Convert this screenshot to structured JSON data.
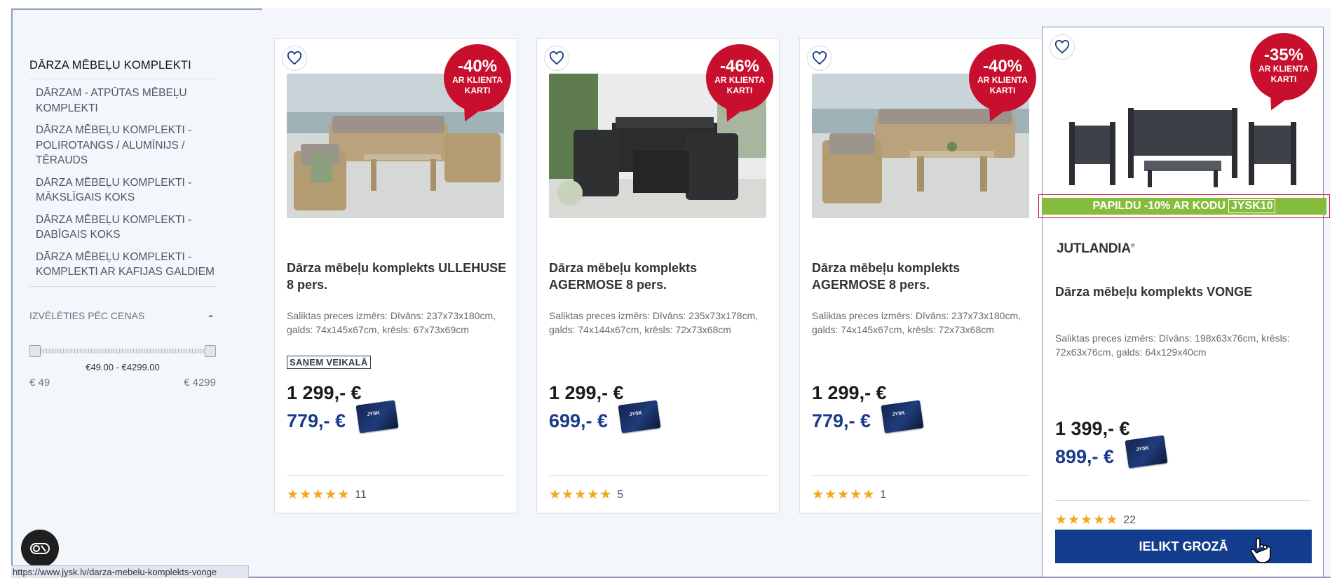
{
  "sidebar": {
    "title": "DĀRZA MĒBEĻU KOMPLEKTI",
    "items": [
      {
        "label": "DĀRZAM - ATPŪTAS MĒBEĻU KOMPLEKTI"
      },
      {
        "label": "DĀRZA MĒBEĻU KOMPLEKTI - POLIROTANGS / ALUMĪNIJS / TĒRAUDS"
      },
      {
        "label": "DĀRZA MĒBEĻU KOMPLEKTI - MĀKSLĪGAIS KOKS"
      },
      {
        "label": "DĀRZA MĒBEĻU KOMPLEKTI - DABĪGAIS KOKS"
      },
      {
        "label": "DĀRZA MĒBEĻU KOMPLEKTI - KOMPLEKTI AR KAFIJAS GALDIEM"
      }
    ],
    "price_filter": {
      "label": "IZVĒLĒTIES PĒC CENAS",
      "collapse": "-",
      "range": "€49.00 - €4299.00",
      "min": "€ 49",
      "max": "€ 4299"
    }
  },
  "products": [
    {
      "discount": "-40%",
      "badge_text": "AR KLIENTA KARTI",
      "name": "Dārza mēbeļu komplekts ULLEHUSE 8 pers.",
      "dims": "Saliktas preces izmērs: Dīvāns: 237x73x180cm, galds: 74x145x67cm, krēsls: 67x73x69cm",
      "pickup": "SAŅEM VEIKALĀ",
      "price_old": "1 299,- €",
      "price_new": "779,- €",
      "rating_count": "11"
    },
    {
      "discount": "-46%",
      "badge_text": "AR KLIENTA KARTI",
      "name": "Dārza mēbeļu komplekts AGERMOSE 8 pers.",
      "dims": "Saliktas preces izmērs: Dīvāns: 235x73x178cm, galds: 74x144x67cm, krēsls: 72x73x68cm",
      "price_old": "1 299,- €",
      "price_new": "699,- €",
      "rating_count": "5"
    },
    {
      "discount": "-40%",
      "badge_text": "AR KLIENTA KARTI",
      "name": "Dārza mēbeļu komplekts AGERMOSE 8 pers.",
      "dims": "Saliktas preces izmērs: Dīvāns: 237x73x180cm, galds: 74x145x67cm, krēsls: 72x73x68cm",
      "price_old": "1 299,- €",
      "price_new": "779,- €",
      "rating_count": "1"
    },
    {
      "discount": "-35%",
      "badge_text": "AR KLIENTA KARTI",
      "promo": "PAPILDU -10% AR KODU",
      "promo_code": "JYSK10",
      "brand": "JUTLANDIA",
      "brand_mark": "®",
      "name": "Dārza mēbeļu komplekts VONGE",
      "dims": "Saliktas preces izmērs: Dīvāns: 198x63x76cm, krēsls: 72x63x76cm, galds: 64x129x40cm",
      "price_old": "1 399,- €",
      "price_new": "899,- €",
      "rating_count": "22",
      "cart_label": "IELIKT GROZĀ"
    }
  ],
  "card_logo": "JYSK",
  "status_url": "https://www.jysk.lv/darza-mebelu-komplekts-vonge",
  "colors": {
    "badge": "#c8102e",
    "promo": "#86bc3b",
    "accent": "#143c8c",
    "star": "#f2a81d"
  }
}
